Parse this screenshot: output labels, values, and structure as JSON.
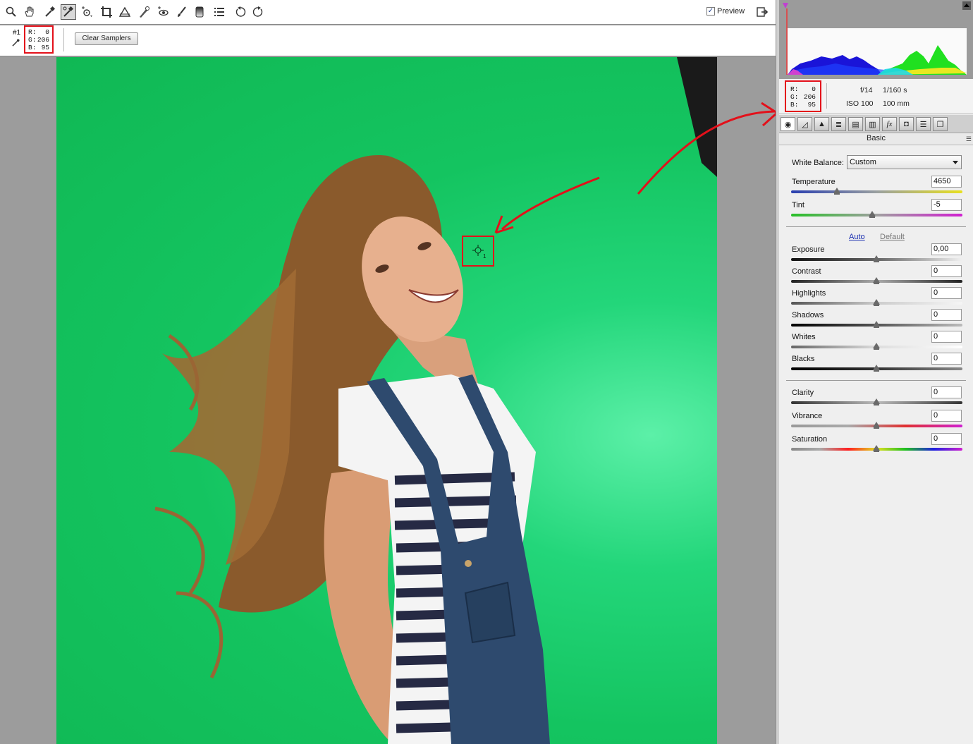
{
  "toolbar": {
    "tools": [
      "zoom-icon",
      "hand-icon",
      "white-balance-icon",
      "color-sampler-icon",
      "targeted-adjustment-icon",
      "crop-icon",
      "straighten-icon",
      "spot-removal-icon",
      "red-eye-icon",
      "adjustment-brush-icon",
      "graduated-filter-icon",
      "preferences-icon",
      "rotate-ccw-icon",
      "rotate-cw-icon"
    ],
    "active_tool": "color-sampler-icon",
    "preview_label": "Preview",
    "preview_checked": true
  },
  "sampler_bar": {
    "sampler_number": "#1",
    "r_label": "R:",
    "r_value": "0",
    "g_label": "G:",
    "g_value": "206",
    "b_label": "B:",
    "b_value": "95",
    "clear_button": "Clear Samplers"
  },
  "canvas": {
    "sampler_marker_number": "1",
    "annotation_color": "#e3101a"
  },
  "histogram": {
    "readout": {
      "r_label": "R:",
      "r_value": "0",
      "g_label": "G:",
      "g_value": "206",
      "b_label": "B:",
      "b_value": "95"
    },
    "aperture": "f/14",
    "shutter": "1/160 s",
    "iso": "ISO 100",
    "focal_length": "100 mm"
  },
  "tabs": [
    "basic-tab-icon",
    "tone-curve-tab-icon",
    "detail-tab-icon",
    "hsl-tab-icon",
    "split-toning-tab-icon",
    "lens-corrections-tab-icon",
    "effects-tab-icon",
    "camera-calibration-tab-icon",
    "presets-tab-icon",
    "snapshots-tab-icon"
  ],
  "panel": {
    "title": "Basic",
    "white_balance_label": "White Balance:",
    "white_balance_value": "Custom",
    "temperature_label": "Temperature",
    "temperature_value": "4650",
    "tint_label": "Tint",
    "tint_value": "-5",
    "auto_label": "Auto",
    "default_label": "Default",
    "exposure_label": "Exposure",
    "exposure_value": "0,00",
    "contrast_label": "Contrast",
    "contrast_value": "0",
    "highlights_label": "Highlights",
    "highlights_value": "0",
    "shadows_label": "Shadows",
    "shadows_value": "0",
    "whites_label": "Whites",
    "whites_value": "0",
    "blacks_label": "Blacks",
    "blacks_value": "0",
    "clarity_label": "Clarity",
    "clarity_value": "0",
    "vibrance_label": "Vibrance",
    "vibrance_value": "0",
    "saturation_label": "Saturation",
    "saturation_value": "0"
  }
}
